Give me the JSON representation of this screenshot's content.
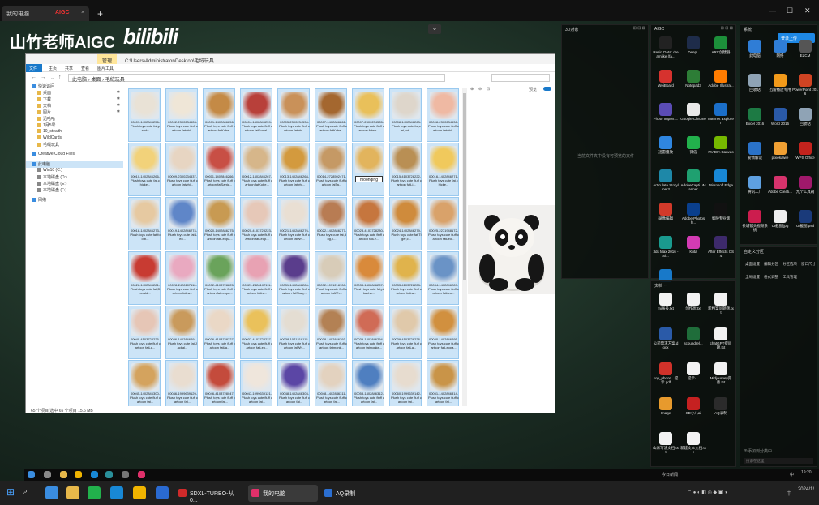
{
  "browser": {
    "tab_title": "我的电脑",
    "tab_badge": "AIGC",
    "tab_close": "×",
    "new_tab": "+",
    "window_controls": [
      "—",
      "☐",
      "✕"
    ]
  },
  "overlay": {
    "channel_name": "山竹老师AIGC",
    "bilibili_logo": "bilibili",
    "collapse": "⌄"
  },
  "explorer": {
    "title_path": "C:\\Users\\Administrator\\Desktop\\毛绒玩具",
    "manage_tab": "管理",
    "ribbon": [
      "文件",
      "主页",
      "共享",
      "查看",
      "图片工具"
    ],
    "breadcrumb": [
      "此电脑",
      "桌面",
      "毛绒玩具"
    ],
    "sidebar": [
      {
        "label": "快速访问",
        "type": "star",
        "pin": false
      },
      {
        "label": "桌面",
        "type": "folder",
        "pin": true
      },
      {
        "label": "下载",
        "type": "folder",
        "pin": true
      },
      {
        "label": "文档",
        "type": "folder",
        "pin": true
      },
      {
        "label": "图片",
        "type": "folder",
        "pin": true
      },
      {
        "label": "迅哈哈",
        "type": "folder",
        "pin": false
      },
      {
        "label": "1月5号",
        "type": "folder",
        "pin": false
      },
      {
        "label": "10_stealth",
        "type": "folder",
        "pin": false
      },
      {
        "label": "WildCards",
        "type": "folder",
        "pin": false
      },
      {
        "label": "毛绒玩具",
        "type": "folder",
        "pin": false
      },
      {
        "label": "Creative Cloud Files",
        "type": "cloud",
        "pin": false
      },
      {
        "label": "此电脑",
        "type": "pc",
        "pin": false,
        "selected": true
      },
      {
        "label": "Win10 (C:)",
        "type": "drive",
        "pin": false
      },
      {
        "label": "本地磁盘 (D:)",
        "type": "drive",
        "pin": false
      },
      {
        "label": "本地磁盘 (E:)",
        "type": "drive",
        "pin": false
      },
      {
        "label": "本地磁盘 (F:)",
        "type": "drive",
        "pin": false
      },
      {
        "label": "网络",
        "type": "net",
        "pin": false
      }
    ],
    "files": [
      {
        "name": "00001-1402846256-Plush toys cute fat,panda",
        "color": "#e9e2d6"
      },
      {
        "name": "00002-2300234528-Plush toys cute fluff cartoon fatwhi...",
        "color": "#efe6d7"
      },
      {
        "name": "00001-1402846256-Plush toys cute fluff cartoon fatKobe...",
        "color": "#c48a46"
      },
      {
        "name": "00004-1402846259-Plush toys cute fluff cartoon fatDonal...",
        "color": "#b8403a"
      },
      {
        "name": "00005-2300234534-Plush toys cute fluff cartoon fatwhi...",
        "color": "#c99159"
      },
      {
        "name": "00007-1402846262-Plush toys cute fluff cartoon fatKobe...",
        "color": "#a4672f"
      },
      {
        "name": "00007-2300234535-Plush toys cute fluff cartoon fatwh...",
        "color": "#e9c05a"
      },
      {
        "name": "00008-1402846263-Plush toys cute fat,cat,cut...",
        "color": "#ded6cb"
      },
      {
        "name": "00008-2300234536-Plush toys cute fluff cartoon fatwhi...",
        "color": "#efb9a3"
      },
      {
        "name": "00010-1402846266-Plush toys cute fat,chicke...",
        "color": "#f2d27a"
      },
      {
        "name": "00009-2300234537-Plush toys cute fluff cartoon fatwhi...",
        "color": "#e7d5c2"
      },
      {
        "name": "00011-1402846266-Plush toys cute fluff cartoon fatSanta...",
        "color": "#c84f45"
      },
      {
        "name": "00012-1402846267-Plush toys cute fluff cartoon fatKobe...",
        "color": "#d6b68a"
      },
      {
        "name": "00013-1402846268-Plush toys cute fluff cartoon fatwhi...",
        "color": "#d39a3e"
      },
      {
        "name": "00014-2728592471-Plush toys cute fluff cartoon fatTa...",
        "color": "#c59965"
      },
      {
        "name": "",
        "color": "#e2b45d",
        "rename": "moonqing"
      },
      {
        "name": "00015-4103728222-Plush toys cute fluff cartoon fatLi...",
        "color": "#b98f54"
      },
      {
        "name": "00016-1402846271-Plush toys cute fat,chicke...",
        "color": "#f0c95c"
      },
      {
        "name": "00018-1402846273-Plush toys cute fat,footb...",
        "color": "#e6c9a1"
      },
      {
        "name": "00019-1402846274-Plush toys cute fat,Leo...",
        "color": "#5f86c8"
      },
      {
        "name": "00020-1402846275-Plush toys cute fluff cartoon fatLeopa...",
        "color": "#c89a52"
      },
      {
        "name": "00020-4103728223-Plush toys cute fluff cartoon fatLeop...",
        "color": "#e6c8b8"
      },
      {
        "name": "00021-1402846276-Plush toys cute fluff cartoon fatWh...",
        "color": "#e9dfd3"
      },
      {
        "name": "00022-1402846277-Plush toys cute fat,dog,c...",
        "color": "#b87c53"
      },
      {
        "name": "00023-4103728230-Plush toys cute fluff cartoon fatLe...",
        "color": "#c6763e"
      },
      {
        "name": "00024-1402846279-Plush toys cute fat,Tiger,c...",
        "color": "#cf8b3c"
      },
      {
        "name": "00025-2271948172-Plush toys cute fluff cartoon fatLeo...",
        "color": "#d9a26a"
      },
      {
        "name": "00026-1402846281-Plush toys cute fat,Donald...",
        "color": "#c83b32"
      },
      {
        "name": "00028-2428107110-Plush toys cute fluff cartoon fatLa...",
        "color": "#e9a9c0"
      },
      {
        "name": "00032-4103728225-Plush toys cute fluff cartoon fatLeopa...",
        "color": "#6aa35b"
      },
      {
        "name": "00029-2428107111-Plush toys cute fluff cartoon fatLa...",
        "color": "#e8a2b3"
      },
      {
        "name": "00031-1402846286-Plush toys cute fluff cartoon fatShaq...",
        "color": "#5a3d8c"
      },
      {
        "name": "00032-1071218108-Plush toys cute fluff cartoon fatWh...",
        "color": "#d8ccb8"
      },
      {
        "name": "00033-1402846287-Plush toys cute fat,pikachu...",
        "color": "#d98a3b"
      },
      {
        "name": "00033-4103728228-Plush toys cute fluff cartoon fatLa...",
        "color": "#e0b34c"
      },
      {
        "name": "00034-1402846289-Plush toys cute fluff cartoon fatLeo...",
        "color": "#6a93c6"
      },
      {
        "name": "00040-4103728225-Plush toys cute fluff cartoon fatLa...",
        "color": "#e6c6b6"
      },
      {
        "name": "00036-1402846291-Plush toys cute fat,Jackal...",
        "color": "#c99a5c"
      },
      {
        "name": "00036-4103728227-Plush toys cute fluff cartoon fatLa...",
        "color": "#ead8c6"
      },
      {
        "name": "00037-4103728227-Plush toys cute fluff cartoon fatLeo...",
        "color": "#eac15b"
      },
      {
        "name": "00038-1071218115-Plush toys cute fluff cartoon fatWh...",
        "color": "#e4ddd2"
      },
      {
        "name": "00038-1402846293-Plush toys cute fluff cartoon fatmonk...",
        "color": "#b38154"
      },
      {
        "name": "00039-1402846294-Plush toys cute fluff cartoon fatmonke...",
        "color": "#d06b56"
      },
      {
        "name": "00039-4103728228-Plush toys cute fluff cartoon fatLa...",
        "color": "#e0c9aa"
      },
      {
        "name": "00040-1402846295-Plush toys cute fluff cartoon fatLeopa...",
        "color": "#d1903f"
      },
      {
        "name": "00045-1402846300-Plush toys cute fluff cartoon fat...",
        "color": "#d4a35e"
      },
      {
        "name": "00046-1999639129-Plush toys cute fluff cartoon fat...",
        "color": "#e9ddd0"
      },
      {
        "name": "00046-4103728047-Plush toys cute fluff cartoon fat...",
        "color": "#c44b3c"
      },
      {
        "name": "00047-1999639121-Plush toys cute fluff cartoon fat...",
        "color": "#efe6dc"
      },
      {
        "name": "00048-1402846303-Plush toys cute fluff cartoon fat...",
        "color": "#5b46a5"
      },
      {
        "name": "00048-1402846311-Plush toys cute fluff cartoon fat...",
        "color": "#e3d2bf"
      },
      {
        "name": "00053-1402846312-Plush toys cute fluff cartoon fat...",
        "color": "#4f7fc0"
      },
      {
        "name": "00060-1999639142-Plush toys cute fluff cartoon fat...",
        "color": "#e7dccf"
      },
      {
        "name": "00051-1402846314-Plush toys cute fluff cartoon fat...",
        "color": "#c99448"
      }
    ],
    "status": "65 个项目    选中 65 个项目 15.6 MB",
    "preview_controls": [
      "⊕",
      "⊖",
      "⊡",
      "预览"
    ]
  },
  "panels": {
    "left": {
      "title": "3D对象",
      "hint": "当前文件夹中没有可预览的文件",
      "controls": "⊞ ⊟ ⊠"
    },
    "aigc": {
      "title": "AIGC",
      "controls": "⊞ ⊟ ⊠",
      "icons": [
        {
          "label": "Resin Data: dreamlike (fa...",
          "color": "#222"
        },
        {
          "label": "DeepL",
          "color": "#1e2c4a"
        },
        {
          "label": "ARC创建器",
          "color": "#1c8f3a"
        },
        {
          "label": "WeiBoard",
          "color": "#d6322e"
        },
        {
          "label": "Notepad3",
          "color": "#2d7d36"
        },
        {
          "label": "Adobe Illustra...",
          "color": "#ff7c00"
        },
        {
          "label": "Photo Import ...",
          "color": "#5b4cb5"
        },
        {
          "label": "Google Chrome",
          "color": "#e8e8e8"
        },
        {
          "label": "Internet Explorer",
          "color": "#1b6fc9"
        },
        {
          "label": "迅雷播放",
          "color": "#2f86e0"
        },
        {
          "label": "微信",
          "color": "#22b14c"
        },
        {
          "label": "NVIDIA Canvas",
          "color": "#76b900"
        },
        {
          "label": "Articulate Storyline 3",
          "color": "#1e88a8"
        },
        {
          "label": "AdobeCapti uManner",
          "color": "#1fa070"
        },
        {
          "label": "Microsoft Edge",
          "color": "#1888d6"
        },
        {
          "label": "录像编辑",
          "color": "#d23a2a"
        },
        {
          "label": "Adobe Photosh...",
          "color": "#0a3f8d"
        },
        {
          "label": "剪映专业版",
          "color": "#111"
        },
        {
          "label": "3ds Max 2016 - Si...",
          "color": "#1a9a8e"
        },
        {
          "label": "Krita",
          "color": "#d33bb3"
        },
        {
          "label": "After Effects CS4",
          "color": "#3d2a6b"
        },
        {
          "label": "...",
          "color": "#1879c9"
        }
      ]
    },
    "desktop": {
      "title": "系统",
      "cloud_button": "登录上传",
      "icons": [
        {
          "label": "此电脑",
          "color": "#2f7dd6"
        },
        {
          "label": "网络",
          "color": "#2f7dd6"
        },
        {
          "label": "EZCM",
          "color": "#555"
        },
        {
          "label": "回收站",
          "color": "#8fa3b5"
        },
        {
          "label": "迅雷播放专用",
          "color": "#f29a1a"
        },
        {
          "label": "PowerPoint 2016",
          "color": "#d04423"
        },
        {
          "label": "Excel 2016",
          "color": "#1d7a44"
        },
        {
          "label": "Word 2016",
          "color": "#2a5aa8"
        },
        {
          "label": "回收站",
          "color": "#8fa3b5"
        },
        {
          "label": "爱情解谜",
          "color": "#2a72c8"
        },
        {
          "label": "pixiekaiwe",
          "color": "#f0a033"
        },
        {
          "label": "WPS Office",
          "color": "#c3231d"
        },
        {
          "label": "腾讯工厂",
          "color": "#5ea0e0"
        },
        {
          "label": "Adobe Creati...",
          "color": "#d6336c"
        },
        {
          "label": "九个工具箱",
          "color": "#a0196b"
        },
        {
          "label": "长城镜头视频系统",
          "color": "#cc1d4e"
        },
        {
          "label": "UI截图.jpg",
          "color": "#eee"
        },
        {
          "label": "UI截图.psd",
          "color": "#1a3a7a"
        }
      ]
    },
    "quickpanel": {
      "title": "自定义分区",
      "items": [
        "桌面设置",
        "编辑分区",
        "分区选项",
        "窗口尺寸",
        "全局设置",
        "格式调整",
        "工具管理"
      ],
      "hint": "⊕添加到分类中",
      "search": "搜索在这里"
    },
    "docs": {
      "title": "文档",
      "icons": [
        {
          "label": "mj账号.txt",
          "color": "#f2f2f2"
        },
        {
          "label": "创作优.txt",
          "color": "#f2f2f2"
        },
        {
          "label": "新档案问题题.txt",
          "color": "#f2f2f2"
        },
        {
          "label": "公司需求方案.docx",
          "color": "#2a5aa8"
        },
        {
          "label": "scoundrel...",
          "color": "#1f6d3a"
        },
        {
          "label": "chatGPT提问题.txt",
          "color": "#f2f2f2"
        },
        {
          "label": "sop_phoon...提示.pdf",
          "color": "#d0322a"
        },
        {
          "label": "提示·...",
          "color": "#f2f2f2"
        },
        {
          "label": "Midjourney完善.txt",
          "color": "#f2f2f2"
        },
        {
          "label": "Image",
          "color": "#e79a2d"
        },
        {
          "label": "SD小八ai",
          "color": "#c62121"
        },
        {
          "label": "AQ录制",
          "color": "#2b2b2b"
        },
        {
          "label": "山东写法文档.txt",
          "color": "#f2f2f2"
        },
        {
          "label": "新建文本文档.txt",
          "color": "#f2f2f2"
        }
      ]
    }
  },
  "inner_taskbar": {
    "clock": "19:20",
    "tray_text": "今日新闻",
    "lang": "中"
  },
  "taskbar": {
    "apps": [
      {
        "label": "SDXL-TURBO-从0...",
        "color": "#d02a2a",
        "active": false
      },
      {
        "label": "我的电脑",
        "color": "#e0306a",
        "active": true
      },
      {
        "label": "AQ录制",
        "color": "#2b6fd1",
        "active": false
      }
    ],
    "clock": "2024/1/",
    "lang": "中"
  }
}
